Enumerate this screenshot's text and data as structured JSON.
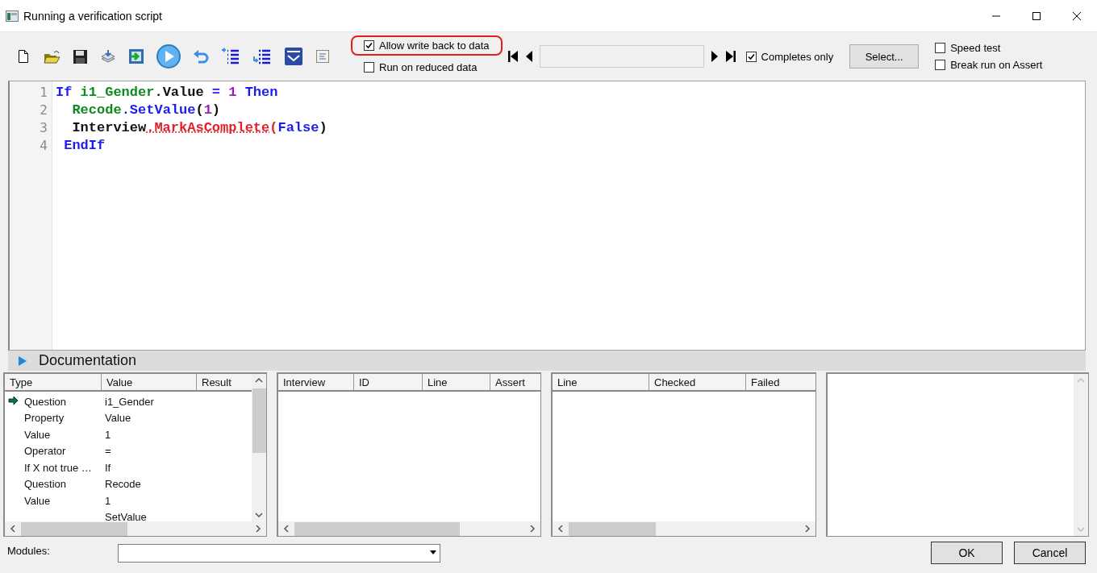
{
  "window": {
    "title": "Running a verification script"
  },
  "toolbar": {
    "options": [
      {
        "label": "Allow write back to data",
        "checked": true,
        "highlighted": true
      },
      {
        "label": "Run on reduced data",
        "checked": false,
        "highlighted": false
      }
    ],
    "completes_only": {
      "label": "Completes only",
      "checked": true
    },
    "select_button": "Select...",
    "test_options": [
      {
        "label": "Speed test",
        "checked": false
      },
      {
        "label": "Break run on Assert",
        "checked": false
      }
    ]
  },
  "editor": {
    "lines": [
      {
        "number": "1",
        "tokens": [
          {
            "text": "If ",
            "kind": "keyword"
          },
          {
            "text": "i1_Gender",
            "kind": "question"
          },
          {
            "text": ".Value ",
            "kind": "plain"
          },
          {
            "text": "= ",
            "kind": "keyword"
          },
          {
            "text": "1 ",
            "kind": "number"
          },
          {
            "text": "Then",
            "kind": "keyword"
          }
        ]
      },
      {
        "number": "2",
        "tokens": [
          {
            "text": "  Recode",
            "kind": "question"
          },
          {
            "text": ".SetValue",
            "kind": "keyword"
          },
          {
            "text": "(",
            "kind": "plain"
          },
          {
            "text": "1",
            "kind": "number"
          },
          {
            "text": ")",
            "kind": "plain"
          }
        ]
      },
      {
        "number": "3",
        "tokens": [
          {
            "text": "  Interview",
            "kind": "plain"
          },
          {
            "text": ".MarkAsComplete",
            "kind": "error"
          },
          {
            "text": "(",
            "kind": "method"
          },
          {
            "text": "False",
            "kind": "keyword"
          },
          {
            "text": ")",
            "kind": "plain"
          }
        ]
      },
      {
        "number": "4",
        "tokens": [
          {
            "text": " EndIf",
            "kind": "keyword"
          }
        ]
      }
    ]
  },
  "documentation": {
    "label": "Documentation",
    "expanded": false
  },
  "panes": [
    {
      "columns": [
        "Type",
        "Value",
        "Result"
      ],
      "rows": [
        {
          "cells": [
            "Question",
            "i1_Gender"
          ],
          "current": true
        },
        {
          "cells": [
            "Property",
            "Value"
          ],
          "current": false
        },
        {
          "cells": [
            "Value",
            "1"
          ],
          "current": false
        },
        {
          "cells": [
            "Operator",
            "="
          ],
          "current": false
        },
        {
          "cells": [
            "If X not true …",
            "If"
          ],
          "current": false
        },
        {
          "cells": [
            "Question",
            "Recode"
          ],
          "current": false
        },
        {
          "cells": [
            "Value",
            "1"
          ],
          "current": false
        },
        {
          "cells": [
            "",
            "SetValue"
          ],
          "current": false
        }
      ]
    },
    {
      "columns": [
        "Interview",
        "ID",
        "Line",
        "Assert"
      ]
    },
    {
      "columns": [
        "Line",
        "Checked",
        "Failed"
      ]
    }
  ],
  "modules": {
    "label": "Modules:"
  },
  "buttons": [
    "OK",
    "Cancel"
  ]
}
